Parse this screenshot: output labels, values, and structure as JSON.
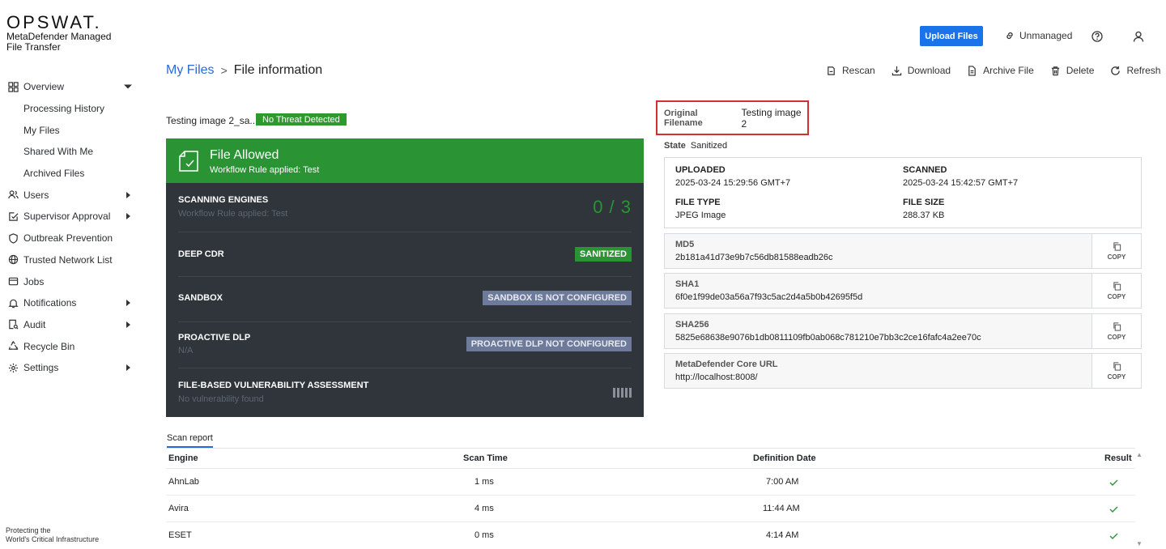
{
  "brand": {
    "logo": "OPSWAT.",
    "product": "MetaDefender Managed File Transfer",
    "footer_line1": "Protecting the",
    "footer_line2": "World's Critical Infrastructure"
  },
  "sidebar": {
    "items": [
      {
        "label": "Overview",
        "icon": "grid-icon",
        "arrow": "down"
      },
      {
        "label": "Processing History",
        "sub": true
      },
      {
        "label": "My Files",
        "sub": true
      },
      {
        "label": "Shared With Me",
        "sub": true
      },
      {
        "label": "Archived Files",
        "sub": true
      },
      {
        "label": "Users",
        "icon": "users-icon",
        "arrow": "right"
      },
      {
        "label": "Supervisor Approval",
        "icon": "approval-icon",
        "arrow": "right"
      },
      {
        "label": "Outbreak Prevention",
        "icon": "shield-icon"
      },
      {
        "label": "Trusted Network List",
        "icon": "globe-icon"
      },
      {
        "label": "Jobs",
        "icon": "jobs-icon"
      },
      {
        "label": "Notifications",
        "icon": "bell-icon",
        "arrow": "right"
      },
      {
        "label": "Audit",
        "icon": "audit-icon",
        "arrow": "right"
      },
      {
        "label": "Recycle Bin",
        "icon": "recycle-icon"
      },
      {
        "label": "Settings",
        "icon": "gear-icon",
        "arrow": "right"
      }
    ]
  },
  "topbar": {
    "upload_label": "Upload Files",
    "unmanaged_label": "Unmanaged"
  },
  "breadcrumb": {
    "parent": "My Files",
    "separator": ">",
    "current": "File information"
  },
  "actions": {
    "rescan": "Rescan",
    "download": "Download",
    "archive": "Archive File",
    "delete": "Delete",
    "refresh": "Refresh"
  },
  "file": {
    "display_name": "Testing image 2_sa...",
    "threat_status": "No Threat Detected",
    "verdict_title": "File Allowed",
    "verdict_sub": "Workflow Rule applied: Test"
  },
  "engines": {
    "scanning_label": "SCANNING ENGINES",
    "scanning_sub": "Workflow Rule applied: Test",
    "scanning_count": "0 / 3",
    "cdr_label": "DEEP CDR",
    "cdr_tag": "SANITIZED",
    "sandbox_label": "SANDBOX",
    "sandbox_tag": "SANDBOX IS NOT CONFIGURED",
    "dlp_label": "PROACTIVE DLP",
    "dlp_sub": "N/A",
    "dlp_tag": "PROACTIVE DLP NOT CONFIGURED",
    "vuln_label": "FILE-BASED VULNERABILITY ASSESSMENT",
    "vuln_sub": "No vulnerability found"
  },
  "details": {
    "original_filename_label": "Original Filename",
    "original_filename": "Testing image 2",
    "state_label": "State",
    "state": "Sanitized",
    "uploaded_label": "UPLOADED",
    "uploaded": "2025-03-24 15:29:56 GMT+7",
    "scanned_label": "SCANNED",
    "scanned": "2025-03-24 15:42:57 GMT+7",
    "filetype_label": "FILE TYPE",
    "filetype": "JPEG Image",
    "filesize_label": "FILE SIZE",
    "filesize": "288.37 KB"
  },
  "hashes": [
    {
      "label": "MD5",
      "value": "2b181a41d73e9b7c56db81588eadb26c"
    },
    {
      "label": "SHA1",
      "value": "6f0e1f99de03a56a7f93c5ac2d4a5b0b42695f5d"
    },
    {
      "label": "SHA256",
      "value": "5825e68638e9076b1db0811109fb0ab068c781210e7bb3c2ce16fafc4a2ee70c"
    },
    {
      "label": "MetaDefender Core URL",
      "value": "http://localhost:8008/"
    }
  ],
  "copy_label": "COPY",
  "report": {
    "tab": "Scan report",
    "columns": [
      "Engine",
      "Scan Time",
      "Definition Date",
      "Result"
    ],
    "rows": [
      {
        "engine": "AhnLab",
        "time": "1 ms",
        "date": "7:00 AM"
      },
      {
        "engine": "Avira",
        "time": "4 ms",
        "date": "11:44 AM"
      },
      {
        "engine": "ESET",
        "time": "0 ms",
        "date": "4:14 AM"
      }
    ]
  },
  "colors": {
    "accent": "#1a73e8",
    "allowed": "#2a9434",
    "panel": "#2f353b",
    "highlight": "#d32f2f"
  }
}
